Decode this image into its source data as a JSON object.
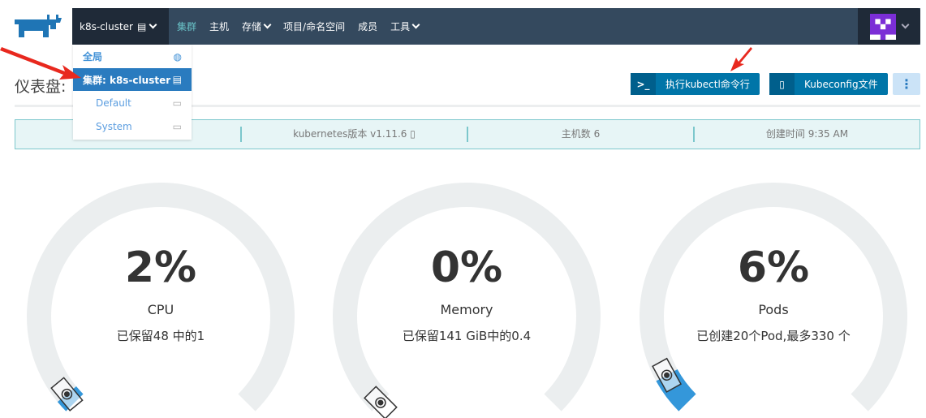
{
  "nav": {
    "cluster": "k8s-cluster",
    "items": [
      {
        "label": "集群",
        "active": true
      },
      {
        "label": "主机"
      },
      {
        "label": "存储",
        "dropdown": true
      },
      {
        "label": "项目/命名空间"
      },
      {
        "label": "成员"
      },
      {
        "label": "工具",
        "dropdown": true
      }
    ]
  },
  "dropdown": {
    "global": "全局",
    "cluster": "集群: k8s-cluster",
    "projects": [
      "Default",
      "System"
    ]
  },
  "page": {
    "title": "仪表盘: "
  },
  "buttons": {
    "kubectl": "执行kubectl命令行",
    "kubeconfig": "Kubeconfig文件",
    "more": "⋮"
  },
  "info": {
    "first": "",
    "k8s_version": "kubernetes版本 v1.11.6",
    "hosts": "主机数 6",
    "created": "创建时间 9:35 AM"
  },
  "gauges": [
    {
      "pct": "2%",
      "value": 2,
      "label": "CPU",
      "sub": "已保留48 中的1"
    },
    {
      "pct": "0%",
      "value": 0,
      "label": "Memory",
      "sub": "已保留141 GiB中的0.4"
    },
    {
      "pct": "6%",
      "value": 6,
      "label": "Pods",
      "sub": "已创建20个Pod,最多330 个"
    }
  ],
  "colors": {
    "nav": "#34495e",
    "accent": "#0075a8",
    "gauge_fill": "#3497da",
    "gauge_track": "#ebeeef",
    "annotation": "#e8281e"
  }
}
